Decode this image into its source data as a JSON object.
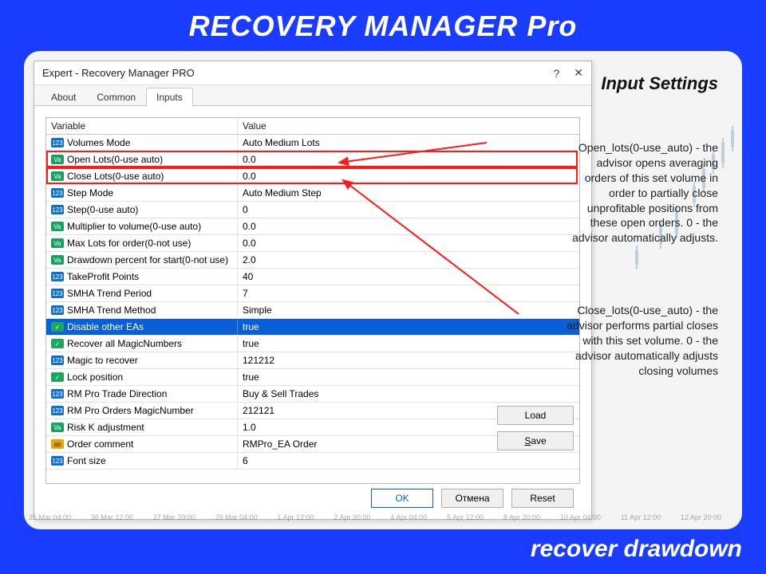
{
  "page": {
    "title": "RECOVERY MANAGER Pro",
    "footer": "recover drawdown"
  },
  "side": {
    "heading": "Input Settings",
    "desc_open": "Open_lots(0-use_auto) - the advisor opens averaging orders of this set volume in order to partially close unprofitable positions from these open orders. 0 - the advisor automatically adjusts.",
    "desc_close": "Close_lots(0-use_auto) - the advisor performs partial closes with this set volume. 0 - the advisor automatically adjusts closing volumes"
  },
  "dialog": {
    "title": "Expert - Recovery Manager PRO",
    "tabs": {
      "about": "About",
      "common": "Common",
      "inputs": "Inputs"
    },
    "grid_headers": {
      "variable": "Variable",
      "value": "Value"
    },
    "buttons": {
      "load": "Load",
      "save": "Save",
      "ok": "OK",
      "cancel": "Отмена",
      "reset": "Reset"
    },
    "rows": [
      {
        "type": "int",
        "label": "Volumes Mode",
        "value": "Auto Medium Lots"
      },
      {
        "type": "dbl",
        "label": "Open Lots(0-use auto)",
        "value": "0.0",
        "highlight": true
      },
      {
        "type": "dbl",
        "label": "Close Lots(0-use auto)",
        "value": "0.0",
        "highlight": true
      },
      {
        "type": "int",
        "label": "Step Mode",
        "value": "Auto Medium Step"
      },
      {
        "type": "int",
        "label": "Step(0-use auto)",
        "value": "0"
      },
      {
        "type": "dbl",
        "label": "Multiplier to volume(0-use auto)",
        "value": "0.0"
      },
      {
        "type": "dbl",
        "label": "Max Lots for order(0-not use)",
        "value": "0.0"
      },
      {
        "type": "dbl",
        "label": "Drawdown percent for start(0-not use)",
        "value": "2.0"
      },
      {
        "type": "int",
        "label": "TakeProfit Points",
        "value": "40"
      },
      {
        "type": "int",
        "label": "SMHA Trend Period",
        "value": "7"
      },
      {
        "type": "int",
        "label": "SMHA Trend Method",
        "value": "Simple"
      },
      {
        "type": "bool",
        "label": "Disable other EAs",
        "value": "true",
        "selected": true
      },
      {
        "type": "bool",
        "label": "Recover all MagicNumbers",
        "value": "true"
      },
      {
        "type": "int",
        "label": "Magic to recover",
        "value": "121212"
      },
      {
        "type": "bool",
        "label": "Lock position",
        "value": "true"
      },
      {
        "type": "int",
        "label": "RM Pro Trade Direction",
        "value": "Buy & Sell Trades"
      },
      {
        "type": "int",
        "label": "RM Pro Orders MagicNumber",
        "value": "212121"
      },
      {
        "type": "dbl",
        "label": "Risk K adjustment",
        "value": "1.0"
      },
      {
        "type": "str",
        "label": "Order comment",
        "value": "RMPro_EA Order"
      },
      {
        "type": "int",
        "label": "Font size",
        "value": "6"
      }
    ]
  },
  "axis_ticks": [
    "25 Mar 04:00",
    "26 Mar 12:00",
    "27 Mar 20:00",
    "29 Mar 04:00",
    "1 Apr 12:00",
    "2 Apr 20:00",
    "4 Apr 04:00",
    "5 Apr 12:00",
    "8 Apr 20:00",
    "10 Apr 04:00",
    "11 Apr 12:00",
    "12 Apr 20:00"
  ]
}
